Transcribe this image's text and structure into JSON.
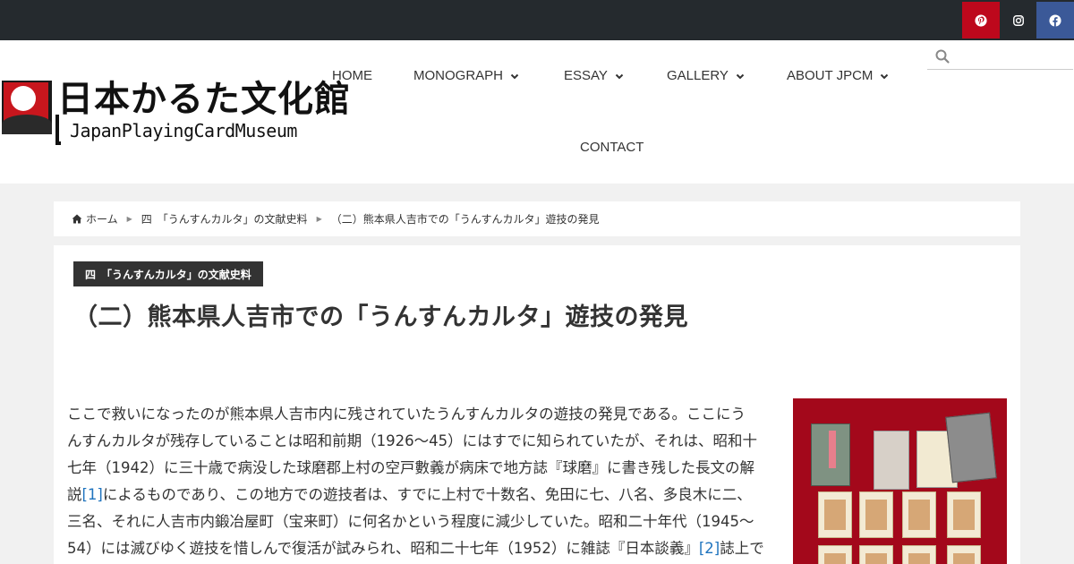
{
  "social": {
    "pinterest_icon": "pinterest-icon",
    "instagram_icon": "instagram-icon",
    "facebook_icon": "facebook-icon",
    "colors": {
      "pinterest": "#bd081c",
      "instagram": "#252a2e",
      "facebook": "#3b5998"
    }
  },
  "logo": {
    "jp": "日本かるた文化館",
    "en": "JapanPlayingCardMuseum"
  },
  "nav": {
    "items": [
      {
        "label": "HOME",
        "has_dropdown": false
      },
      {
        "label": "MONOGRAPH",
        "has_dropdown": true
      },
      {
        "label": "ESSAY",
        "has_dropdown": true
      },
      {
        "label": "GALLERY",
        "has_dropdown": true
      },
      {
        "label": "ABOUT JPCM",
        "has_dropdown": true
      },
      {
        "label": "CONTACT",
        "has_dropdown": false
      }
    ],
    "chevron": "⌄"
  },
  "search": {
    "placeholder": "",
    "value": ""
  },
  "breadcrumb": {
    "home": "ホーム",
    "category": "四　「うんすんカルタ」の文献史料",
    "current": "（二）熊本県人吉市での「うんすんカルタ」遊技の発見"
  },
  "article": {
    "category_label": "四　「うんすんカルタ」の文献史料",
    "title": "（二）熊本県人吉市での「うんすんカルタ」遊技の発見",
    "lines": [
      "ここで救いになったのが熊本県人吉市内に残されていたうんすんカルタの遊技の発見である。ここにう",
      "んすんカルタが残存していることは昭和前期（1926～45）にはすでに知られていたが、それは、昭和十",
      "七年（1942）に三十歳で病没した球磨郡上村の空戸數義が病床で地方誌『球磨』に書き残した長文の解",
      "説",
      "[1]",
      "によるものであり、この地方での遊技者は、すでに上村で十数名、免田に七、八名、多良木に二、",
      "三名、それに人吉市内鍛冶屋町（宝来町）に何名かという程度に減少していた。昭和二十年代（1945～",
      "54）には滅びゆく遊技を惜しんで復活が試みられ、昭和二十七年（1952）に雑誌『日本談義』",
      "[2]",
      "誌上で"
    ]
  }
}
